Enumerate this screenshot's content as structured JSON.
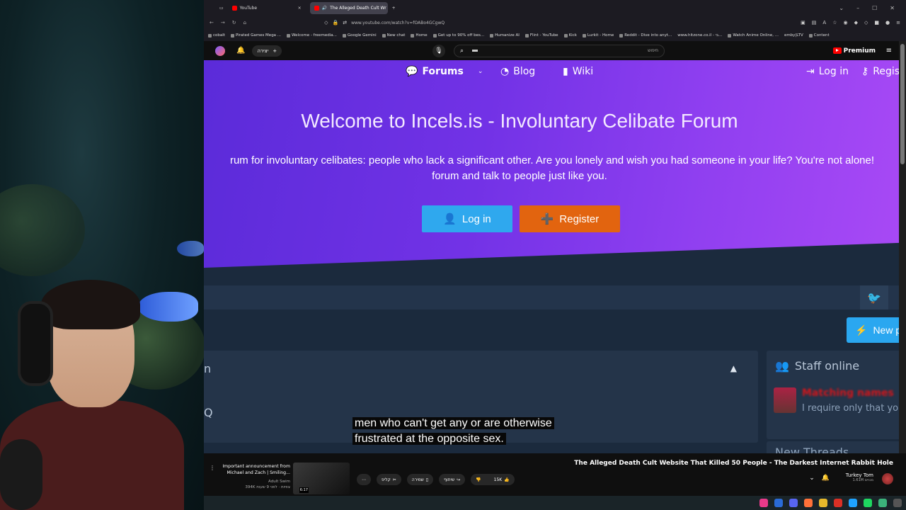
{
  "browser": {
    "tabs": [
      {
        "label": "YouTube",
        "active": false
      },
      {
        "label": "The Alleged Death Cult Wr",
        "active": true
      }
    ],
    "new_tab": "+",
    "url": "www.youtube.com/watch?v=fOABo4GCgwQ",
    "bookmarks": [
      "cobalt",
      "Pirated Games Mega ...",
      "Welcome - freemedia...",
      "Google Gemini",
      "New chat",
      "Home",
      "Get up to 90% off bes...",
      "Humanize AI",
      "Flint - YouTube",
      "Kick",
      "Lurkit - Home",
      "Reddit - Dive into anyt...",
      "www.hitzone.co.il - בי...",
      "Watch Anime Online, ...",
      "emby|LTV",
      "Content"
    ]
  },
  "youtube": {
    "create_label": "יצירה",
    "search_placeholder": "חיפוש",
    "logo_label": "Premium"
  },
  "site": {
    "nav": {
      "forums": "Forums",
      "blog": "Blog",
      "wiki": "Wiki",
      "login": "Log in",
      "register": "Regis"
    },
    "title": "Welcome to Incels.is - Involuntary Celibate Forum",
    "subtitle_line1": "rum for involuntary celibates: people who lack a significant other. Are you lonely and wish you had someone in your life? You're not alone!",
    "subtitle_line2": "forum and talk to people just like you.",
    "login_button": "Log in",
    "register_button": "Register",
    "new_post": "New po",
    "panel_left_letter1": "n",
    "panel_left_letter2": "Q",
    "staff_online": "Staff online",
    "staff_name": "Matching names",
    "staff_quote": "I require only that you",
    "new_threads": "New Threads"
  },
  "caption": {
    "line1": "men who can't get any or are otherwise",
    "line2": "frustrated at the opposite sex."
  },
  "player": {
    "next_title": "Important announcement from Michael and Zach | Smiling...",
    "next_channel": "Adult Swim",
    "next_meta": "394K צפיות · לפני 9 שעות",
    "next_duration": "6:17",
    "clip_label": "קליפ",
    "save_label": "שמירה",
    "share_label": "שיתוף",
    "like_count": "15K",
    "video_title": "The Alleged Death Cult Website That Killed 50 People - The Darkest Internet Rabbit Hole",
    "channel_name": "Turkey Tom",
    "channel_subs": "1.61M מנויים"
  }
}
